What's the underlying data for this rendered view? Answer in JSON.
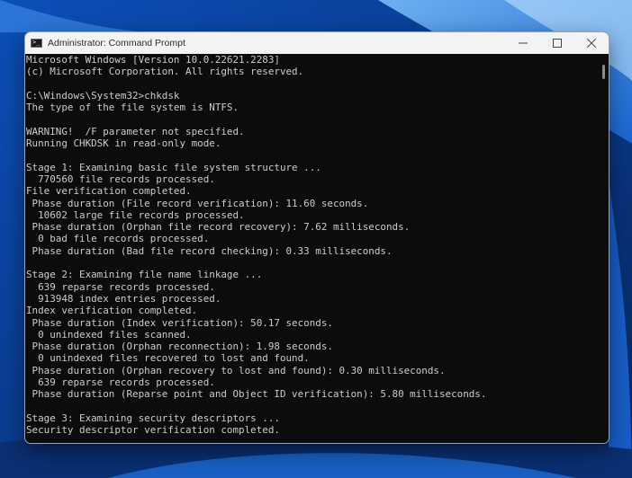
{
  "window": {
    "title": "Administrator: Command Prompt",
    "controls": {
      "minimize": "minimize",
      "maximize": "maximize",
      "close": "close"
    }
  },
  "console": {
    "lines": [
      "Microsoft Windows [Version 10.0.22621.2283]",
      "(c) Microsoft Corporation. All rights reserved.",
      "",
      "C:\\Windows\\System32>chkdsk",
      "The type of the file system is NTFS.",
      "",
      "WARNING!  /F parameter not specified.",
      "Running CHKDSK in read-only mode.",
      "",
      "Stage 1: Examining basic file system structure ...",
      "  770560 file records processed.",
      "File verification completed.",
      " Phase duration (File record verification): 11.60 seconds.",
      "  10602 large file records processed.",
      " Phase duration (Orphan file record recovery): 7.62 milliseconds.",
      "  0 bad file records processed.",
      " Phase duration (Bad file record checking): 0.33 milliseconds.",
      "",
      "Stage 2: Examining file name linkage ...",
      "  639 reparse records processed.",
      "  913948 index entries processed.",
      "Index verification completed.",
      " Phase duration (Index verification): 50.17 seconds.",
      "  0 unindexed files scanned.",
      " Phase duration (Orphan reconnection): 1.98 seconds.",
      "  0 unindexed files recovered to lost and found.",
      " Phase duration (Orphan recovery to lost and found): 0.30 milliseconds.",
      "  639 reparse records processed.",
      " Phase duration (Reparse point and Object ID verification): 5.80 milliseconds.",
      "",
      "Stage 3: Examining security descriptors ...",
      "Security descriptor verification completed."
    ]
  },
  "colors": {
    "console_bg": "#0c0c0c",
    "console_text": "#cccccc",
    "titlebar_bg": "#f3f3f3",
    "wallpaper_base": "#0a3a8c"
  }
}
